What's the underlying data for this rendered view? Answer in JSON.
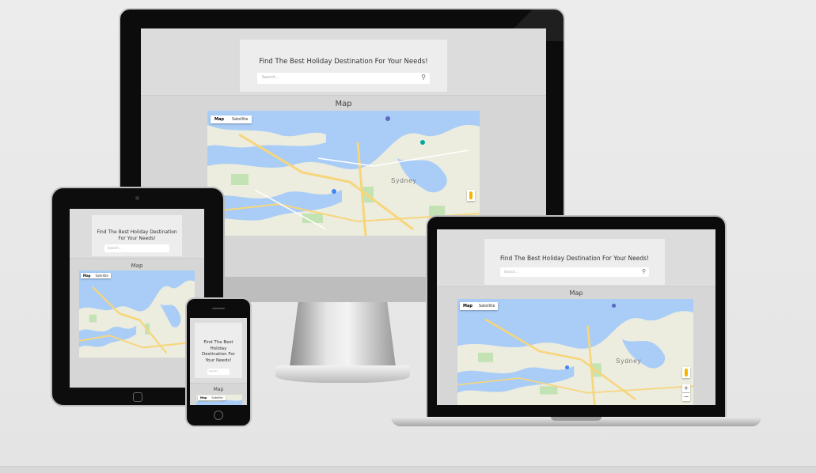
{
  "site": {
    "title": "Find The Best Holiday Destination For Your Needs!",
    "search_placeholder": "Search...",
    "map_heading": "Map",
    "map_type": [
      "Map",
      "Satellite"
    ],
    "map_label": "Sydney",
    "zoom_in": "+",
    "zoom_out": "−",
    "search_icon": "magnifier-icon"
  },
  "colors": {
    "water": "#a9cdf7",
    "land": "#ececdf",
    "park": "#c4e3b4",
    "road": "#f7d67a",
    "page_bg": "#dcdcdc",
    "hero_bg": "#ededed"
  }
}
